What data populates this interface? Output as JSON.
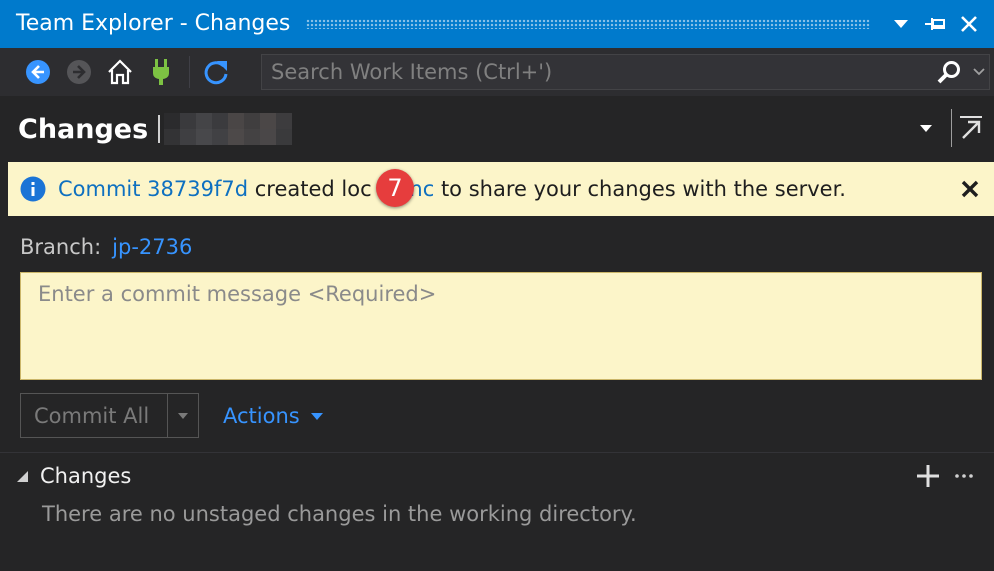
{
  "window": {
    "title": "Team Explorer - Changes"
  },
  "toolbar": {
    "search_placeholder": "Search Work Items (Ctrl+')",
    "icons": [
      "back-icon",
      "forward-icon",
      "home-icon",
      "connect-icon",
      "refresh-icon",
      "search-icon"
    ]
  },
  "page": {
    "title": "Changes"
  },
  "notification": {
    "commit_link": "Commit 38739f7d",
    "text_before_badge": " created loc",
    "sync_link": "Sync",
    "text_after": " to share your changes with the server.",
    "badge": "7"
  },
  "branch": {
    "label": "Branch:",
    "name": "jp-2736"
  },
  "commit_message": {
    "placeholder": "Enter a commit message <Required>",
    "value": ""
  },
  "buttons": {
    "commit_all": "Commit All",
    "actions": "Actions"
  },
  "changes_section": {
    "title": "Changes",
    "empty_message": "There are no unstaged changes in the working directory."
  },
  "colors": {
    "accent": "#007acc",
    "background": "#252526",
    "toolbar": "#2d2d30",
    "info_bar": "#fcf5c9",
    "link": "#3794ff",
    "badge": "#e63d3d",
    "connect_icon": "#7dc243"
  }
}
